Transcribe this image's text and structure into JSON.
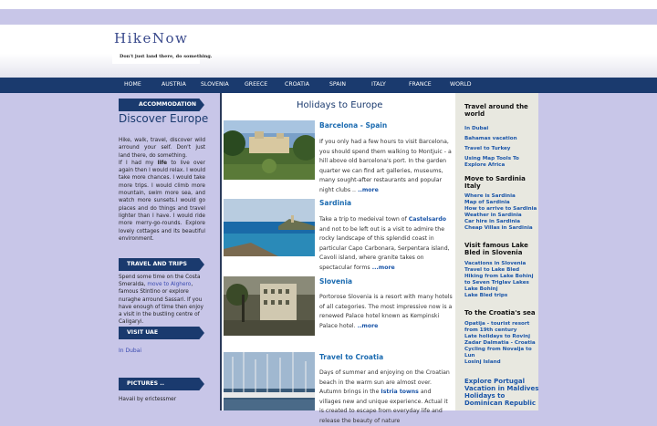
{
  "site": {
    "logo": "HikeNow",
    "tagline": "Don't just land there, do something."
  },
  "nav": [
    "HOME",
    "AUSTRIA",
    "SLOVENIA",
    "GREECE",
    "CROATIA",
    "SPAIN",
    "ITALY",
    "FRANCE",
    "WORLD"
  ],
  "left": {
    "accommodation_header": "ACCOMMODATION",
    "discover_title": "Discover Europe",
    "intro_a": "Hike, walk, travel, discover wild arround your self. Don't just land there, do something.",
    "intro_b1": "If I had my ",
    "intro_life": "life",
    "intro_b2": " to live over again then I would relax. I would take more chances. I would take more trips. I would climb more mountain, swim more sea, and watch more sunsets.I would go places and do things and travel lighter than I have. I would ride more merry-go-rounds. Explore lovely cottages and its beautiful environment.",
    "travel_header": "TRAVEL AND TRIPS",
    "travel_text_1": "Spend some time on the Costa Smeralda, ",
    "travel_link": "move to Alghero",
    "travel_text_2": ", famous Stintino or explore nuraghe arround Sassari. If you have enough of time then enjoy a visit in the bustling centre of Caligaryi.",
    "uae_header": "VISIT UAE",
    "uae_link": "In Dubai",
    "pictures_header": "PICTURES ..",
    "pictures_credit": "Havaii by erictessmer"
  },
  "main": {
    "title": "Holidays to Europe",
    "articles": [
      {
        "title": "Barcelona - Spain",
        "body": "If you only had a few hours to visit Barcelona, you should spend them walking to Montjuic - a hill above old barcelona's port. In the garden quarter we can find art galleries, museums, many sought-after restaurants and popular night clubs ..",
        "more": " ..more"
      },
      {
        "title": "Sardinia",
        "body_1": "Take a trip to medeival town of ",
        "link": "Castelsardo",
        "body_2": " and not to be left out is a visit to admire the rocky landscape of this splendid coast in particular Capo Carbonara, Serpentara island, Cavoli island, where granite takes on spectacular forms",
        "more": " ...more"
      },
      {
        "title": "Slovenia",
        "body": "Portorose Slovenia is a resort with many hotels of all categories. The most impressive now is a renewed Palace hotel known as Kempinski Palace hotel.",
        "more": " ..more"
      },
      {
        "title": "Travel to Croatia",
        "body_1": "Days of summer and enjoying on the Croatian beach in the warm sun are almost over. Autumn brings in the ",
        "link": "Istria towns",
        "body_2": " and villages new and unique experience. Actual it is created to escape from everyday life and release the beauty of nature"
      }
    ]
  },
  "right": {
    "sections": [
      {
        "title": "Travel around the world",
        "links": [
          "In Dubai",
          "Bahamas vacation",
          "Travel to Turkey",
          "Using Map Tools To",
          "Explore Africa"
        ]
      },
      {
        "title": "Move to Sardinia Italy",
        "links": [
          "Where is Sardinia",
          "Map of Sardinia",
          "How to arrive to Sardinia",
          "Weather in Sardinia",
          "Car hire in Sardinia",
          "Cheap Villas in Sardinia"
        ]
      },
      {
        "title": "Visit famous Lake Bled in Slovenia",
        "links": [
          "Vacations in Slovenia",
          "Travel to Lake Bled",
          "Hiking from Lake Bohinj",
          "to Seven Triglav Lakes",
          "Lake Bohinj",
          "Lake Bled trips"
        ]
      },
      {
        "title": "To the Croatia's sea",
        "links": [
          "Opatija - tourist resort",
          "from 19th century",
          "Late holidays to Rovinj",
          "Zadar Dalmatia - Croatia",
          "Cycling from Novalja to",
          "Lun",
          "Losinj Island"
        ]
      }
    ],
    "bottom_link": "Explore Portugal Vacation in Maldives Holidays to Dominican Republic"
  },
  "colors": {
    "navy": "#1a3a6e",
    "lavender": "#c8c6e8",
    "link": "#1a55a8"
  }
}
